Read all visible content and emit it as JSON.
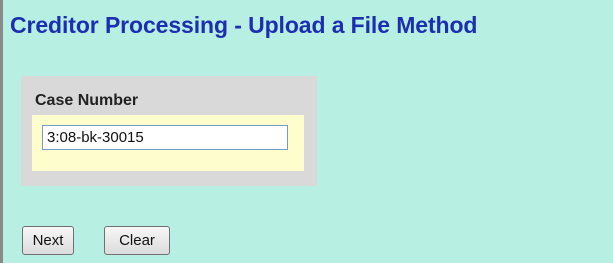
{
  "page": {
    "title": "Creditor Processing - Upload a File Method"
  },
  "case_number": {
    "label": "Case Number",
    "value": "3:08-bk-30015"
  },
  "buttons": {
    "next_label": "Next",
    "clear_label": "Clear"
  },
  "colors": {
    "background": "#b7efe2",
    "title": "#1c2fb0",
    "panel": "#d9d9d9",
    "panel_inner": "#fdfdce"
  }
}
